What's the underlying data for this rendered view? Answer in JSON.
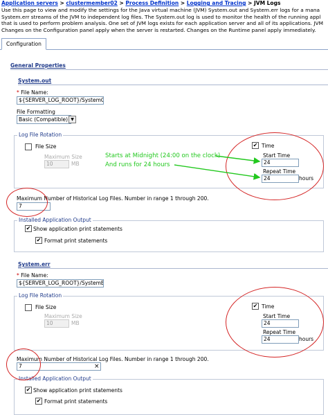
{
  "breadcrumb": {
    "items": [
      "Application servers",
      "clustermember02",
      "Process Definition",
      "Logging and Tracing"
    ],
    "separator": ">",
    "current": "JVM Logs"
  },
  "description": [
    "Use this page to view and modify the settings for the Java virtual machine (JVM) System.out and System.err logs for a mana",
    "System.err streams of the JVM to independent log files. The System.out log is used to monitor the health of the running appl",
    "that is used to perform problem analysis. One set of JVM logs exists for each application server and all of its applications. JVM",
    "Changes on the Configuration panel apply when the server is restarted. Changes on the Runtime panel apply immediately."
  ],
  "tabs": {
    "configuration": "Configuration"
  },
  "general_properties": "General Properties",
  "sysout": {
    "title": "System.out",
    "file_name_label": "File Name:",
    "file_name_value": "${SERVER_LOG_ROOT}/SystemO",
    "file_formatting_label": "File Formatting",
    "file_formatting_value": "Basic (Compatible)",
    "rotation_legend": "Log File Rotation",
    "file_size_label": "File Size",
    "max_size_label": "Maximum Size",
    "max_size_value": "10",
    "max_size_unit": "MB",
    "time_label": "Time",
    "start_time_label": "Start Time",
    "start_time_value": "24",
    "repeat_time_label": "Repeat Time",
    "repeat_time_value": "24",
    "repeat_time_unit": "hours",
    "max_hist_label": "Maximum Number of Historical Log Files. Number in range 1 through 200.",
    "max_hist_value": "7",
    "installed_output_legend": "Installed Application Output",
    "show_print_label": "Show application print statements",
    "format_print_label": "Format print statements"
  },
  "syserr": {
    "title": "System.err",
    "file_name_label": "File Name:",
    "file_name_value": "${SERVER_LOG_ROOT}/SystemE",
    "rotation_legend": "Log File Rotation",
    "file_size_label": "File Size",
    "max_size_label": "Maximum Size",
    "max_size_value": "10",
    "max_size_unit": "MB",
    "time_label": "Time",
    "start_time_label": "Start Time",
    "start_time_value": "24",
    "repeat_time_label": "Repeat Time",
    "repeat_time_value": "24",
    "repeat_time_unit": "hours",
    "max_hist_label": "Maximum Number of Historical Log Files. Number in range 1 through 200.",
    "max_hist_value": "7",
    "clear_glyph": "×",
    "installed_output_legend": "Installed Application Output",
    "show_print_label": "Show application print statements",
    "format_print_label": "Format print statements"
  },
  "annotation": {
    "line1": "Starts at Midnight (24:00 on the clock)",
    "line2": "And runs for 24 hours"
  },
  "glyphs": {
    "check": "✔",
    "arrow_down": "▼",
    "required": "*"
  },
  "colors": {
    "link": "#0033cc",
    "annotation": "#22c81e",
    "circle": "#d42424",
    "header": "#1f3a8a"
  }
}
